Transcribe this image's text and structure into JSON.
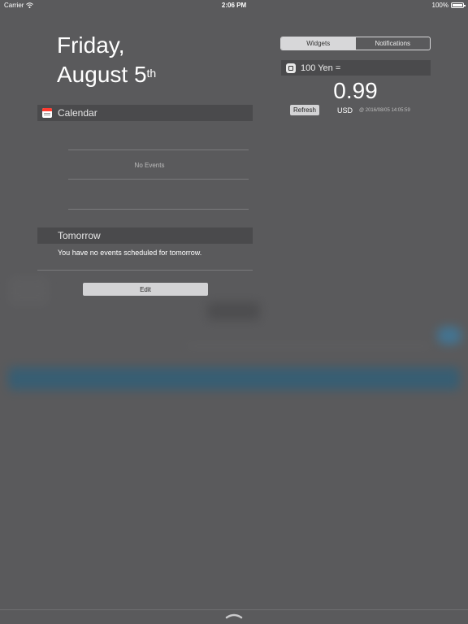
{
  "status_bar": {
    "carrier": "Carrier",
    "time": "2:06 PM",
    "battery": "100%"
  },
  "date": {
    "line1": "Friday,",
    "line2": "August 5",
    "ordinal": "th"
  },
  "calendar": {
    "title": "Calendar",
    "empty_text": "No Events"
  },
  "tomorrow": {
    "title": "Tomorrow",
    "message": "You have no events scheduled for tomorrow."
  },
  "edit_label": "Edit",
  "tabs": [
    {
      "label": "Widgets",
      "selected": true
    },
    {
      "label": "Notifications",
      "selected": false
    }
  ],
  "widget": {
    "title": "100 Yen =",
    "value": "0.99",
    "refresh_label": "Refresh",
    "currency": "USD",
    "timestamp": "@ 2016/08/05 14:05:59"
  },
  "colors": {
    "background": "#5a5a5c",
    "header_bar": "#4a4a4c",
    "button": "#d3d3d5"
  },
  "icons": [
    "wifi-icon",
    "battery-icon",
    "calendar-app-icon",
    "currency-app-icon",
    "chevron-handle-icon"
  ]
}
